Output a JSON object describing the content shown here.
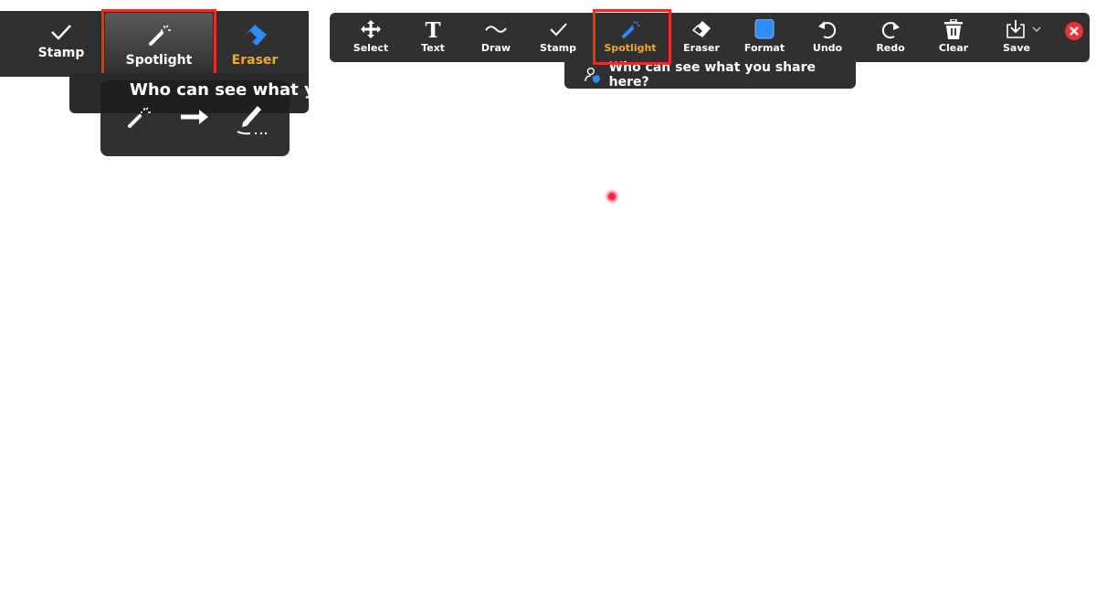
{
  "inset": {
    "tools": [
      {
        "label": "Stamp",
        "icon": "checkmark-icon"
      },
      {
        "label": "Spotlight",
        "icon": "magic-wand-icon"
      },
      {
        "label": "Eraser",
        "icon": "eraser-icon"
      }
    ],
    "tooltip": "Who can see what yo",
    "submenu": [
      {
        "icon": "spotlight-wand-icon"
      },
      {
        "icon": "arrow-icon"
      },
      {
        "icon": "vanishing-pen-icon"
      }
    ]
  },
  "toolbar": {
    "tools": [
      {
        "label": "Select",
        "icon": "move-icon"
      },
      {
        "label": "Text",
        "icon": "text-icon"
      },
      {
        "label": "Draw",
        "icon": "squiggle-icon"
      },
      {
        "label": "Stamp",
        "icon": "checkmark-icon"
      },
      {
        "label": "Spotlight",
        "icon": "magic-wand-icon",
        "active": true
      },
      {
        "label": "Eraser",
        "icon": "eraser-icon"
      },
      {
        "label": "Format",
        "icon": "color-square-icon"
      },
      {
        "label": "Undo",
        "icon": "undo-icon"
      },
      {
        "label": "Redo",
        "icon": "redo-icon"
      },
      {
        "label": "Clear",
        "icon": "trash-icon"
      },
      {
        "label": "Save",
        "icon": "save-icon"
      }
    ],
    "close_icon": "close-icon",
    "tooltip": "Who can see what you share here?"
  },
  "colors": {
    "toolbar_bg": "#303030",
    "active": "#f5a623",
    "accent_blue": "#2d8cff",
    "highlight": "#e8301c",
    "close": "#e8333a",
    "pointer": "#ff2040"
  }
}
